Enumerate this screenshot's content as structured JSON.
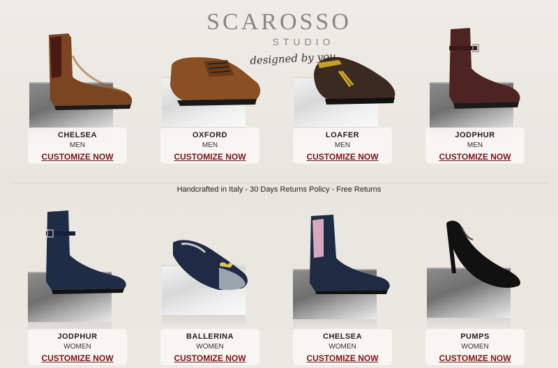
{
  "logo": {
    "brand": "SCAROSSO",
    "studio": "STUDIO",
    "tagline": "designed by you"
  },
  "banner": "Handcrafted in Italy - 30 Days Returns Policy - Free Returns",
  "products": [
    {
      "name": "CHELSEA",
      "gender": "MEN",
      "cta": "CUSTOMIZE NOW",
      "shoe_icon": "chelsea-boot-brown",
      "color": "#7a4520"
    },
    {
      "name": "OXFORD",
      "gender": "MEN",
      "cta": "CUSTOMIZE NOW",
      "shoe_icon": "oxford-brown",
      "color": "#8a4f22"
    },
    {
      "name": "LOAFER",
      "gender": "MEN",
      "cta": "CUSTOMIZE NOW",
      "shoe_icon": "loafer-dark-brown",
      "color": "#3a2a22"
    },
    {
      "name": "JODPHUR",
      "gender": "MEN",
      "cta": "CUSTOMIZE NOW",
      "shoe_icon": "jodphur-boot-burgundy",
      "color": "#4e2422"
    },
    {
      "name": "JODPHUR",
      "gender": "WOMEN",
      "cta": "CUSTOMIZE NOW",
      "shoe_icon": "jodphur-boot-navy",
      "color": "#1e2c45"
    },
    {
      "name": "BALLERINA",
      "gender": "WOMEN",
      "cta": "CUSTOMIZE NOW",
      "shoe_icon": "ballerina-navy-grey",
      "color": "#1f2a44"
    },
    {
      "name": "CHELSEA",
      "gender": "WOMEN",
      "cta": "CUSTOMIZE NOW",
      "shoe_icon": "chelsea-boot-navy-pink",
      "color": "#1e2b42"
    },
    {
      "name": "PUMPS",
      "gender": "WOMEN",
      "cta": "CUSTOMIZE NOW",
      "shoe_icon": "pumps-black",
      "color": "#111111"
    }
  ],
  "colors": {
    "cta": "#7a1218",
    "background": "#ece8e2"
  }
}
